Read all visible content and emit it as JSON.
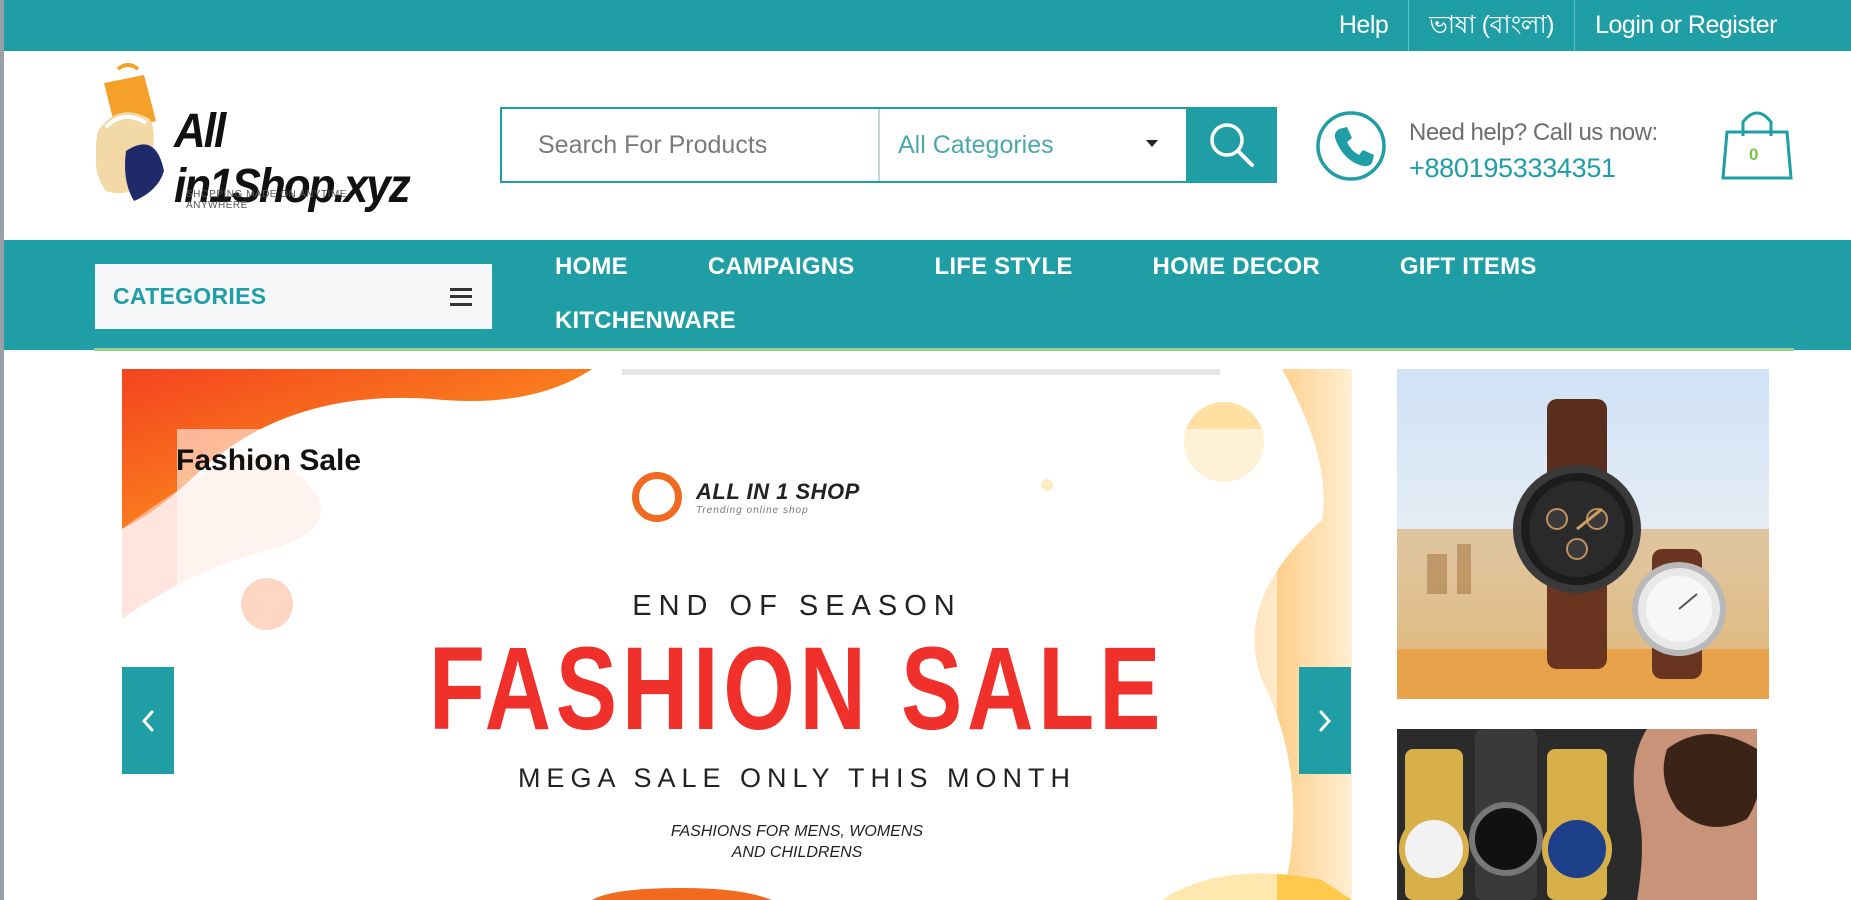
{
  "topbar": {
    "links": [
      "Help",
      "ভাষা (বাংলা)",
      "Login or Register"
    ]
  },
  "header": {
    "logo_text": "All in1Shop.xyz",
    "logo_tagline": "SHOPPING MADE ON ANYTIME ANYWHERE",
    "search": {
      "placeholder": "Search For Products",
      "category_selected": "All Categories"
    },
    "help": {
      "label": "Need help? Call us now:",
      "phone": "+8801953334351"
    },
    "cart_count": "0"
  },
  "nav": {
    "categories_label": "CATEGORIES",
    "items_row1": [
      "HOME",
      "CAMPAIGNS",
      "LIFE STYLE",
      "HOME DECOR",
      "GIFT ITEMS"
    ],
    "items_row2": [
      "KITCHENWARE"
    ]
  },
  "slider": {
    "slide_title": "Fashion Sale",
    "brand_name": "ALL IN 1 SHOP",
    "brand_tagline": "Trending online shop",
    "headline_top": "END OF SEASON",
    "headline_main": "FASHION SALE",
    "headline_sub": "MEGA SALE ONLY THIS MONTH",
    "fine_print_1": "FASHIONS FOR MENS, WOMENS",
    "fine_print_2": "AND CHILDRENS"
  },
  "colors": {
    "brand_teal": "#1f9ea6",
    "sale_red": "#f0302b",
    "accent_orange": "#f26a1f"
  },
  "icons": [
    "search-icon",
    "phone-icon",
    "shopping-bag-icon",
    "menu-icon",
    "chevron-left-icon",
    "chevron-right-icon"
  ]
}
